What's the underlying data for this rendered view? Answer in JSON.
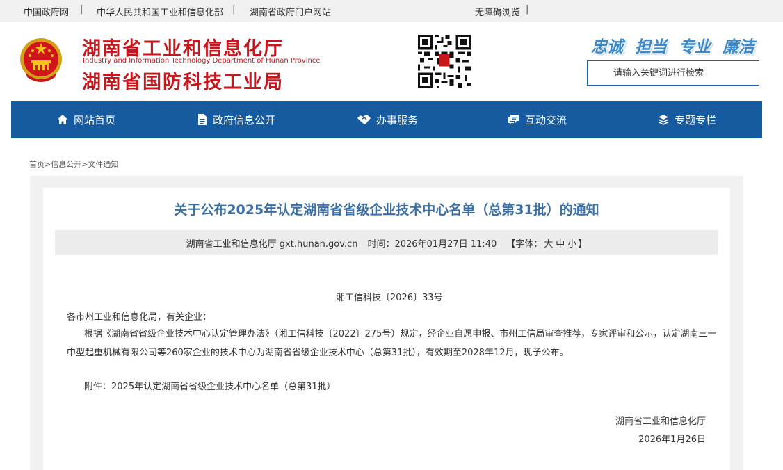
{
  "topbar": {
    "links": [
      "中国政府网",
      "中华人民共和国工业和信息化部",
      "湖南省政府门户网站"
    ],
    "separator": "|",
    "accessibility": "无障碍浏览"
  },
  "header": {
    "title_line1": "湖南省工业和信息化厅",
    "title_en": "Industry and Information Technology Department of Hunan Province",
    "title_line2": "湖南省国防科技工业局",
    "slogans": [
      "忠诚",
      "担当",
      "专业",
      "廉洁"
    ],
    "search_placeholder": "请输入关键词进行检索"
  },
  "nav": {
    "items": [
      {
        "label": "网站首页",
        "icon": "home-icon"
      },
      {
        "label": "政府信息公开",
        "icon": "document-icon"
      },
      {
        "label": "办事服务",
        "icon": "handshake-icon"
      },
      {
        "label": "互动交流",
        "icon": "chat-icon"
      },
      {
        "label": "专题专栏",
        "icon": "layers-icon"
      }
    ]
  },
  "breadcrumb": {
    "items": [
      "首页",
      "信息公开",
      "文件通知"
    ],
    "separator": ">"
  },
  "article": {
    "title": "关于公布2025年认定湖南省省级企业技术中心名单（总第31批）的通知",
    "source": "湖南省工业和信息化厅 gxt.hunan.gov.cn",
    "time_label": "时间：",
    "time": "2026年01月27日 11:40",
    "font_label": "【字体：",
    "font_sizes": [
      "大",
      "中",
      "小"
    ],
    "font_close": "】",
    "doc_number": "湘工信科技〔2026〕33号",
    "salutation": "各市州工业和信息化局，有关企业：",
    "paragraph_line1": "根据《湖南省省级企业技术中心认定管理办法》（湘工信科技〔2022〕275号）规定，经企业自愿申报、市州工信局审查推荐，专家评审和公示，认定湖南三一",
    "paragraph_line2": "中型起重机械有限公司等260家企业的技术中心为湖南省省级企业技术中心（总第31批），有效期至2028年12月，现予公布。",
    "attachment": "附件：2025年认定湖南省省级企业技术中心名单（总第31批）",
    "signature": "湖南省工业和信息化厅",
    "date": "2026年1月26日"
  },
  "colors": {
    "nav_bg": "#165aa0",
    "title_red": "#c8161d",
    "article_title": "#3a6fa6",
    "slogan": "#3a87c9"
  }
}
